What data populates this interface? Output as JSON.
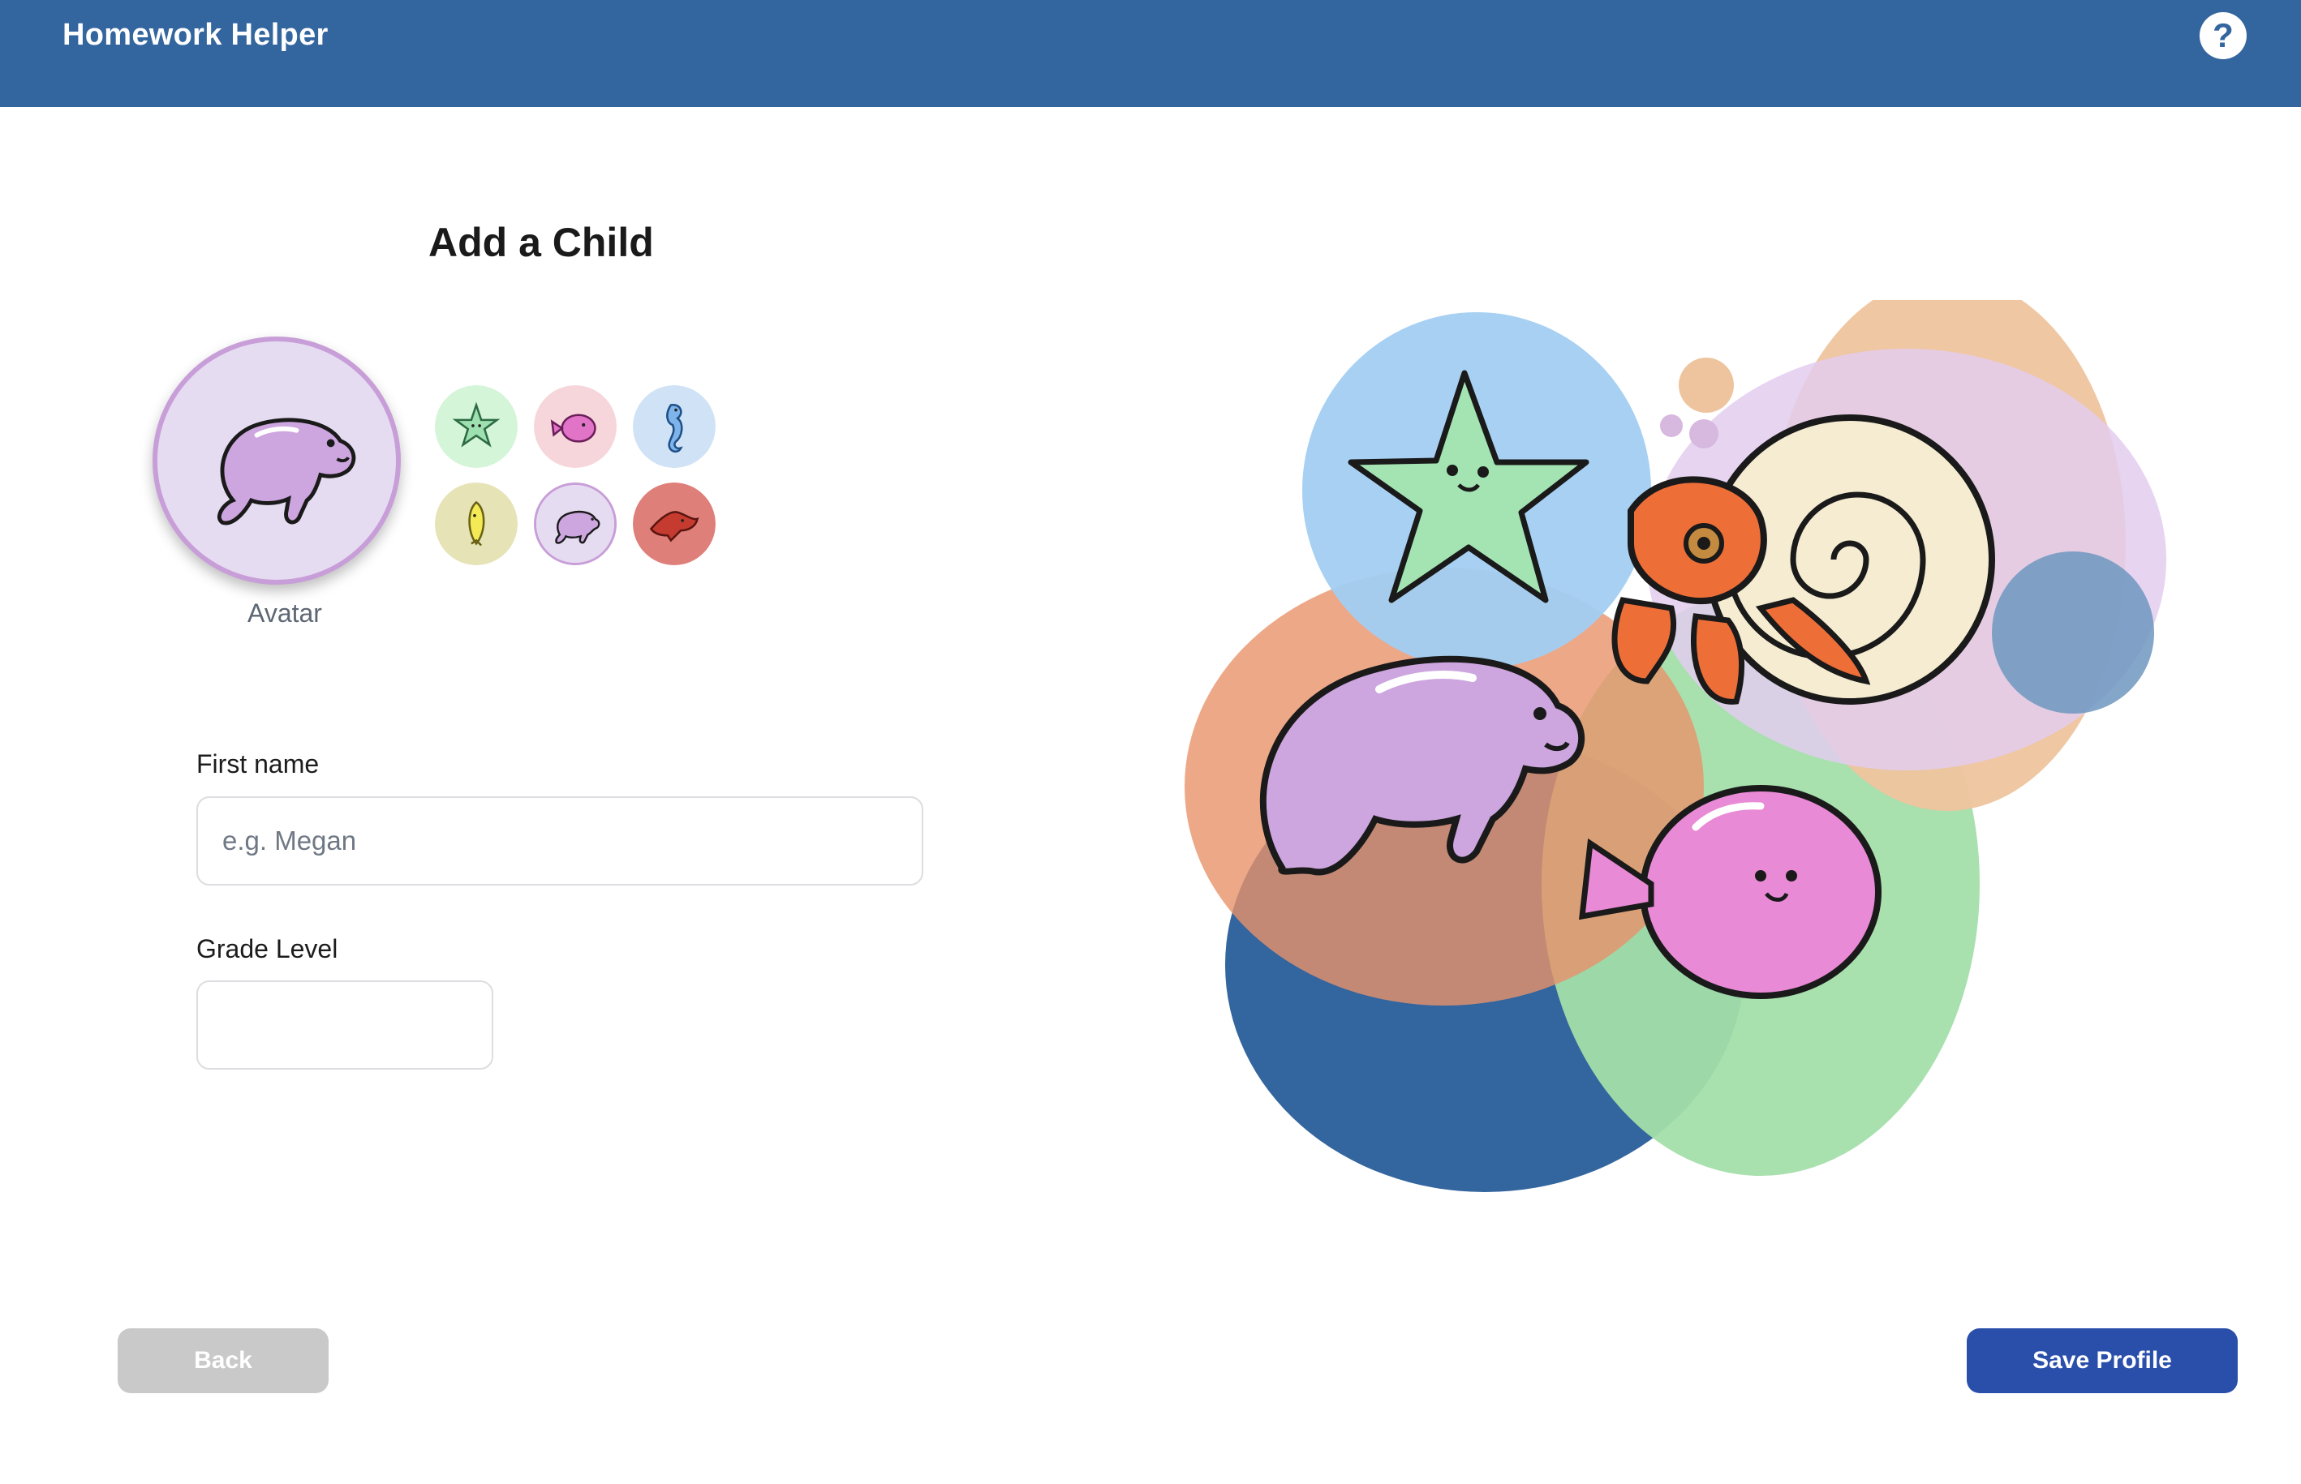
{
  "header": {
    "app_title": "Homework Helper",
    "help_icon": "question-mark-icon",
    "help_symbol": "?",
    "background_color": "#33659e"
  },
  "page": {
    "title": "Add a Child"
  },
  "avatar": {
    "label": "Avatar",
    "selected": "manatee",
    "options": [
      {
        "name": "starfish",
        "color": "#d4f5d8"
      },
      {
        "name": "pufferfish",
        "color": "#f6d6db"
      },
      {
        "name": "seahorse",
        "color": "#cfe2f6"
      },
      {
        "name": "fish",
        "color": "#e6e4b6"
      },
      {
        "name": "manatee",
        "color": "#e6dcf2"
      },
      {
        "name": "stingray",
        "color": "#de7f79"
      }
    ]
  },
  "form": {
    "first_name_label": "First name",
    "first_name_placeholder": "e.g. Megan",
    "first_name_value": "",
    "grade_level_label": "Grade Level",
    "grade_level_value": ""
  },
  "buttons": {
    "back_label": "Back",
    "save_label": "Save Profile"
  },
  "illustration": {
    "subjects": [
      "starfish",
      "hermit-crab",
      "manatee",
      "pufferfish"
    ]
  }
}
